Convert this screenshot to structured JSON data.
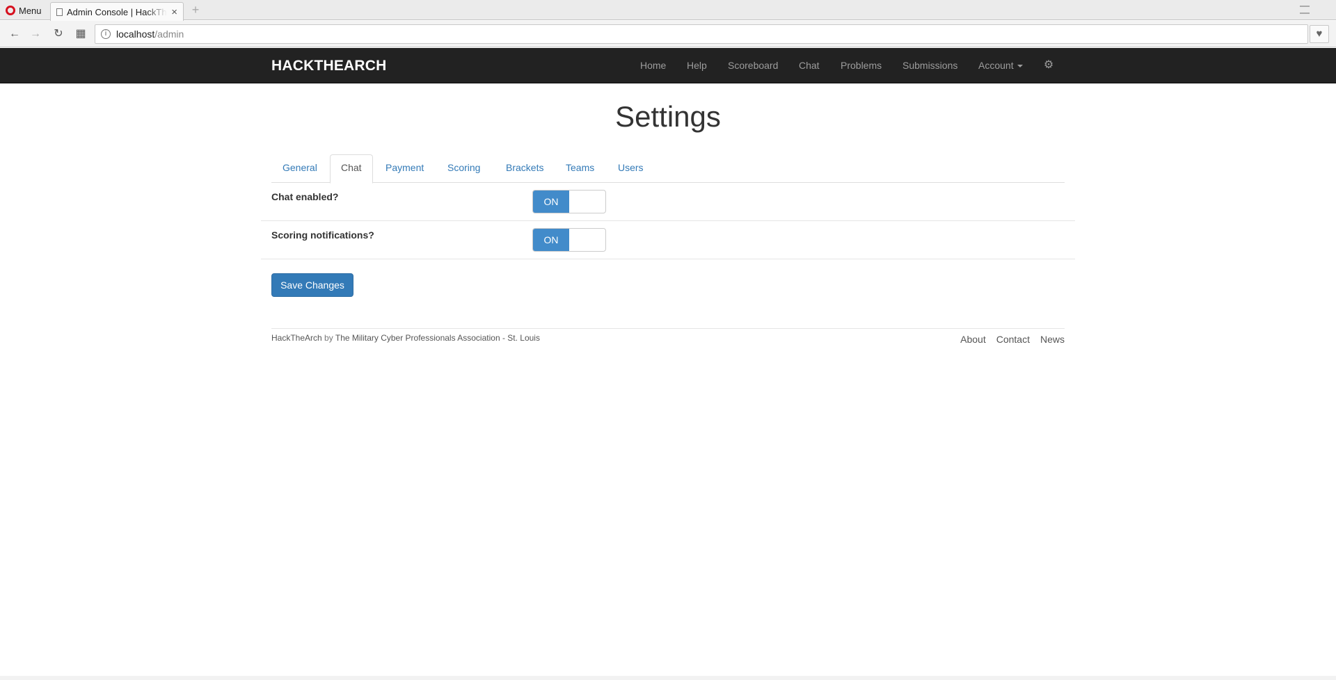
{
  "browser": {
    "menu_label": "Menu",
    "tab_title": "Admin Console | HackTheArch",
    "tab_close": "×",
    "new_tab": "+",
    "url_host": "localhost",
    "url_path": "/admin",
    "back": "←",
    "forward": "→",
    "reload": "↻",
    "speed_dial": "▦",
    "info": "i",
    "favorite": "♥"
  },
  "navbar": {
    "brand": "HACKTHEARCH",
    "links": [
      "Home",
      "Help",
      "Scoreboard",
      "Chat",
      "Problems",
      "Submissions",
      "Account"
    ],
    "settings_icon": "gear-icon",
    "gear": "⚙"
  },
  "page": {
    "title": "Settings",
    "tabs": [
      "General",
      "Chat",
      "Payment",
      "Scoring",
      "Brackets",
      "Teams",
      "Users"
    ],
    "active_tab": "Chat"
  },
  "settings": [
    {
      "label": "Chat enabled?",
      "state": "ON"
    },
    {
      "label": "Scoring notifications?",
      "state": "ON"
    }
  ],
  "save_label": "Save Changes",
  "footer": {
    "app": "HackTheArch",
    "by": "by",
    "org": "The Military Cyber Professionals Association - St. Louis",
    "links": [
      "About",
      "Contact",
      "News"
    ]
  },
  "colors": {
    "navbar_bg": "#222222",
    "link": "#337ab7",
    "switch_on": "#428bca"
  }
}
